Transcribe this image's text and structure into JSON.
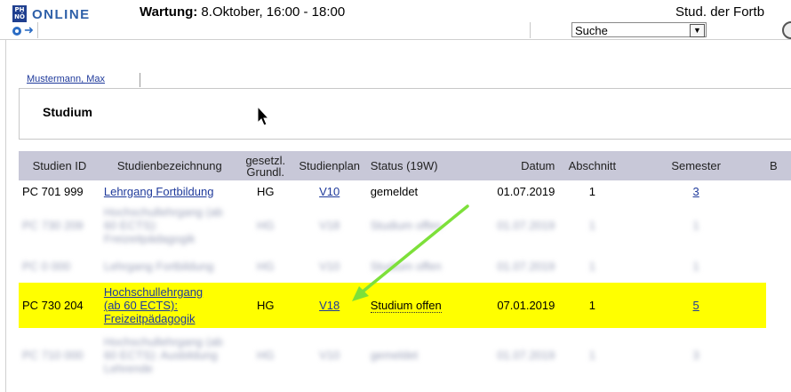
{
  "header": {
    "logo_mark": "PH\nNÖ",
    "logo_text": "ONLINE",
    "maintenance_label": "Wartung:",
    "maintenance_text": " 8.Oktober, 16:00 - 18:00",
    "user_info": "Stud. der Fortb"
  },
  "toolbar": {
    "search_value": "Suche"
  },
  "tabs": {
    "person_tab": "Mustermann, Max"
  },
  "section": {
    "title": "Studium"
  },
  "table": {
    "headers": [
      "Studien ID",
      "Studienbezeichnung",
      "gesetzl.\nGrundl.",
      "Studienplan",
      "Status (19W)",
      "Datum",
      "Abschnitt",
      "Semester",
      "B"
    ],
    "rows": [
      {
        "id": "PC 701 999",
        "name": "Lehrgang Fortbildung",
        "basis": "HG",
        "plan": "V10",
        "status": "gemeldet",
        "date": "01.07.2019",
        "section": "1",
        "semester": "3"
      },
      {
        "id": "PC 730 209",
        "name": "Hochschullehrgang (ab 60 ECTS): Freizeitpädagogik",
        "basis": "HG",
        "plan": "V18",
        "status": "Studium offen",
        "date": "01.07.2019",
        "section": "1",
        "semester": "1"
      },
      {
        "id": "PC 0 000",
        "name": "Lehrgang Fortbildung",
        "basis": "HG",
        "plan": "V10",
        "status": "Studium offen",
        "date": "01.07.2019",
        "section": "1",
        "semester": "1"
      },
      {
        "id": "PC 730 204",
        "name_lines": [
          "Hochschullehrgang",
          "(ab 60 ECTS):",
          "Freizeitpädagogik"
        ],
        "basis": "HG",
        "plan": "V18",
        "status": "Studium offen",
        "date": "07.01.2019",
        "section": "1",
        "semester": "5"
      },
      {
        "id": "PC 710 000",
        "name": "Hochschullehrgang (ab 60 ECTS): Ausbildung Lehrende",
        "basis": "HG",
        "plan": "V10",
        "status": "gemeldet",
        "date": "01.07.2019",
        "section": "1",
        "semester": "3"
      }
    ]
  },
  "colors": {
    "highlight": "#ffff00",
    "arrow": "#7de03a",
    "link": "#1f3a9b",
    "header_bg": "#c8c8d8"
  }
}
